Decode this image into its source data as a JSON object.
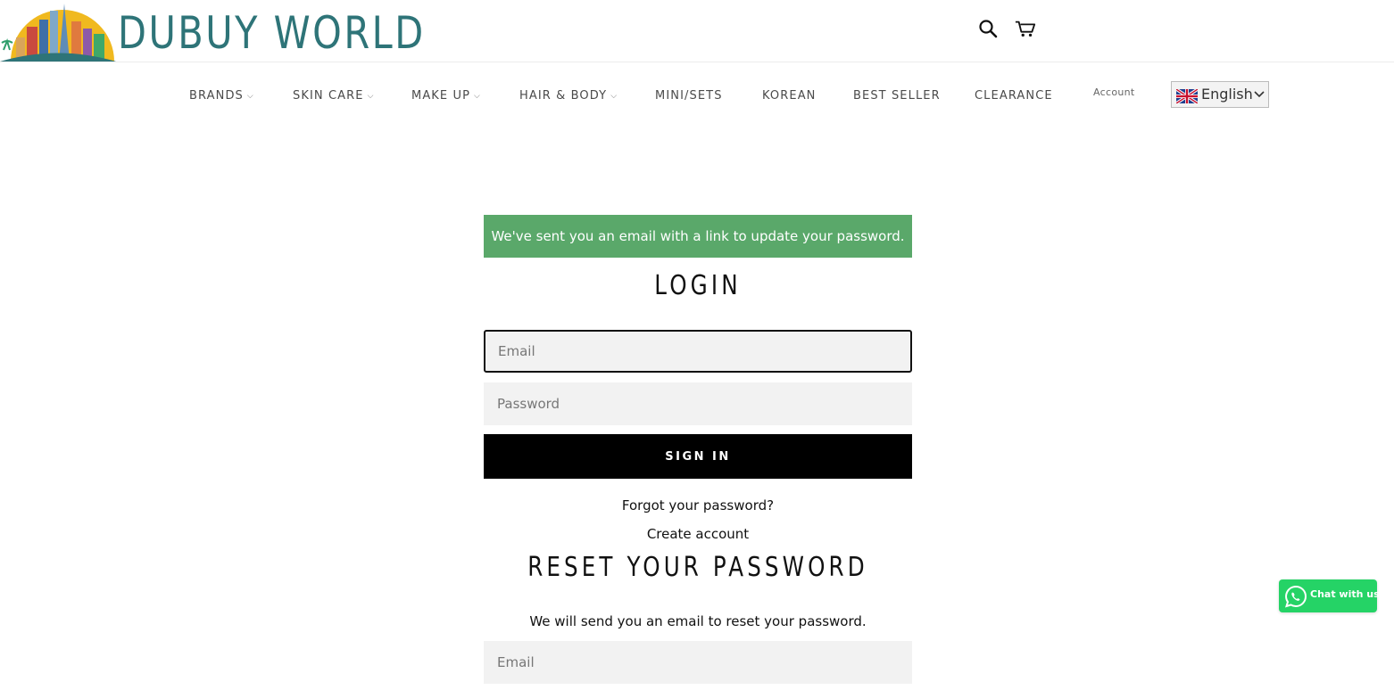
{
  "header": {
    "logo_text": "DUBUY WORLD",
    "brand_color": "#2e7478",
    "search_icon": "search-icon",
    "cart_icon": "cart-icon"
  },
  "nav": {
    "items": [
      {
        "label": "BRANDS",
        "has_dropdown": true
      },
      {
        "label": "SKIN CARE",
        "has_dropdown": true
      },
      {
        "label": "MAKE UP",
        "has_dropdown": true
      },
      {
        "label": "HAIR & BODY",
        "has_dropdown": true
      },
      {
        "label": "MINI/SETS",
        "has_dropdown": false
      },
      {
        "label": "KOREAN",
        "has_dropdown": false
      },
      {
        "label": "BEST SELLER",
        "has_dropdown": false
      },
      {
        "label": "CLEARANCE",
        "has_dropdown": false
      }
    ],
    "account_label": "Account",
    "language": {
      "selected": "English",
      "flag_icon": "uk-flag-icon"
    }
  },
  "main": {
    "success_message": "We've sent you an email with a link to update your password.",
    "success_color": "#5aa86a",
    "login": {
      "title": "LOGIN",
      "email_placeholder": "Email",
      "password_placeholder": "Password",
      "sign_in_label": "SIGN IN",
      "forgot_link": "Forgot your password?",
      "create_link": "Create account"
    },
    "reset": {
      "title": "RESET YOUR PASSWORD",
      "description": "We will send you an email to reset your password.",
      "email_placeholder": "Email"
    }
  },
  "chat": {
    "label": "Chat with us",
    "icon": "whatsapp-icon",
    "color": "#25d366"
  }
}
